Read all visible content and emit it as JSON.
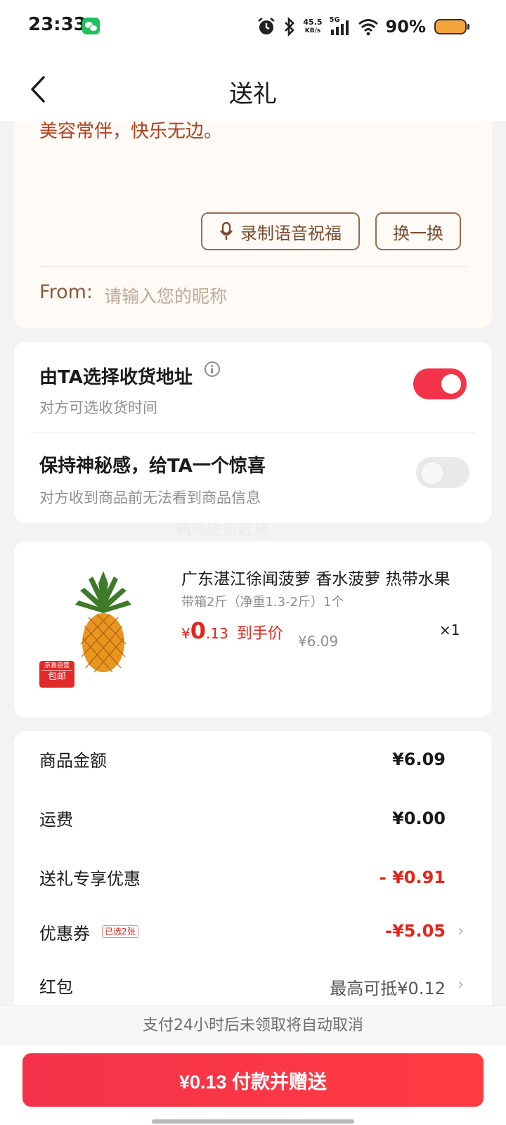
{
  "status_bar": {
    "time": "23:33",
    "network_speed_value": "45.5",
    "network_speed_unit": "KB/s",
    "signal_type": "5G",
    "battery_percent": "90%",
    "icons": [
      "wechat-icon",
      "alarm-icon",
      "bluetooth-icon",
      "signal-icon",
      "wifi-icon",
      "battery-icon"
    ]
  },
  "header": {
    "title": "送礼",
    "back_icon": "chevron-left-icon"
  },
  "message_card": {
    "message_text_partial": "美容常伴，快乐无边。",
    "record_voice_label": "录制语音祝福",
    "switch_label": "换一换",
    "from_label": "From:",
    "from_placeholder": "请输入您的昵称"
  },
  "options": {
    "address": {
      "title": "由TA选择收货地址",
      "subtitle": "对方可选收货时间",
      "enabled": true
    },
    "mystery": {
      "title": "保持神秘感，给TA一个惊喜",
      "subtitle": "对方收到商品前无法看到商品信息",
      "enabled": false
    }
  },
  "watermark": "鸭鸭进京赶烤",
  "product": {
    "title": "广东湛江徐闻菠萝 香水菠萝 热带水果",
    "spec": "带箱2斤（净重1.3-2斤）1个",
    "price_symbol": "¥",
    "price_int": "0",
    "price_dec": ".13",
    "price_label": "到手价",
    "original_price": "¥6.09",
    "quantity": "×1",
    "badge_top": "京喜自营",
    "badge_bottom": "包邮"
  },
  "fees": {
    "goods_amount_label": "商品金额",
    "goods_amount": "¥6.09",
    "shipping_label": "运费",
    "shipping": "¥0.00",
    "gift_discount_label": "送礼专享优惠",
    "gift_discount": "- ¥0.91",
    "coupon_label": "优惠券",
    "coupon_tag": "已选2张",
    "coupon_value": "-¥5.05",
    "red_packet_label": "红包",
    "red_packet_value": "最高可抵¥0.12"
  },
  "notice": "支付24小时后未领取将自动取消",
  "pay_button": "¥0.13 付款并赠送",
  "colors": {
    "accent_red": "#e1251b",
    "button_red": "#f5324a",
    "card_cream": "#fefaf5",
    "brown": "#8b5a3c"
  }
}
